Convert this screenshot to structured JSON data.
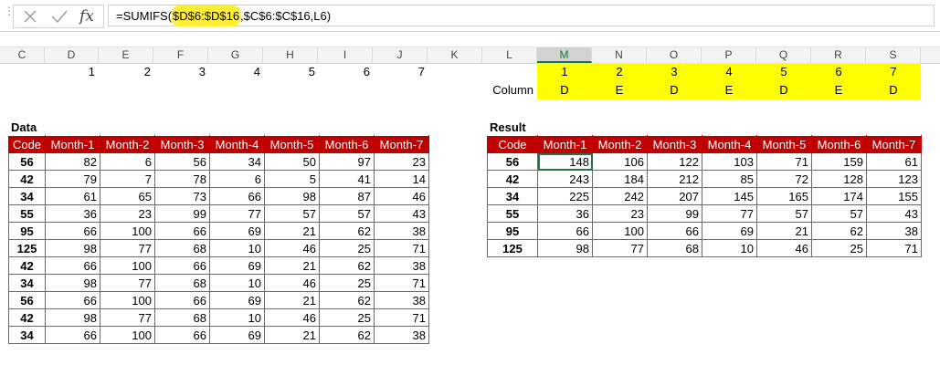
{
  "formula_bar": {
    "cancel_icon": "x-icon",
    "enter_icon": "check-icon",
    "fx_label": "fx",
    "formula_prefix": "=SUMIFS(",
    "formula_highlight": "$D$6:$D$16",
    "formula_suffix": ",$C$6:$C$16,L6)",
    "highlight_color": "#ffee33"
  },
  "column_headers": [
    "C",
    "D",
    "E",
    "F",
    "G",
    "H",
    "I",
    "J",
    "K",
    "L",
    "M",
    "N",
    "O",
    "P",
    "Q",
    "R",
    "S"
  ],
  "selected_column": "M",
  "index_row_left": [
    "1",
    "2",
    "3",
    "4",
    "5",
    "6",
    "7"
  ],
  "column_label": "Column",
  "index_row_right": [
    "1",
    "2",
    "3",
    "4",
    "5",
    "6",
    "7"
  ],
  "letter_row_right": [
    "D",
    "E",
    "D",
    "E",
    "D",
    "E",
    "D"
  ],
  "data_table": {
    "title": "Data",
    "headers": [
      "Code",
      "Month-1",
      "Month-2",
      "Month-3",
      "Month-4",
      "Month-5",
      "Month-6",
      "Month-7"
    ],
    "rows": [
      [
        "56",
        "82",
        "6",
        "56",
        "34",
        "50",
        "97",
        "23"
      ],
      [
        "42",
        "79",
        "7",
        "78",
        "6",
        "5",
        "41",
        "14"
      ],
      [
        "34",
        "61",
        "65",
        "73",
        "66",
        "98",
        "87",
        "46"
      ],
      [
        "55",
        "36",
        "23",
        "99",
        "77",
        "57",
        "57",
        "43"
      ],
      [
        "95",
        "66",
        "100",
        "66",
        "69",
        "21",
        "62",
        "38"
      ],
      [
        "125",
        "98",
        "77",
        "68",
        "10",
        "46",
        "25",
        "71"
      ],
      [
        "42",
        "66",
        "100",
        "66",
        "69",
        "21",
        "62",
        "38"
      ],
      [
        "34",
        "98",
        "77",
        "68",
        "10",
        "46",
        "25",
        "71"
      ],
      [
        "56",
        "66",
        "100",
        "66",
        "69",
        "21",
        "62",
        "38"
      ],
      [
        "42",
        "98",
        "77",
        "68",
        "10",
        "46",
        "25",
        "71"
      ],
      [
        "34",
        "66",
        "100",
        "66",
        "69",
        "21",
        "62",
        "38"
      ]
    ]
  },
  "result_table": {
    "title": "Result",
    "headers": [
      "Code",
      "Month-1",
      "Month-2",
      "Month-3",
      "Month-4",
      "Month-5",
      "Month-6",
      "Month-7"
    ],
    "rows": [
      [
        "56",
        "148",
        "106",
        "122",
        "103",
        "71",
        "159",
        "61"
      ],
      [
        "42",
        "243",
        "184",
        "212",
        "85",
        "72",
        "128",
        "123"
      ],
      [
        "34",
        "225",
        "242",
        "207",
        "145",
        "165",
        "174",
        "155"
      ],
      [
        "55",
        "36",
        "23",
        "99",
        "77",
        "57",
        "57",
        "43"
      ],
      [
        "95",
        "66",
        "100",
        "66",
        "69",
        "21",
        "62",
        "38"
      ],
      [
        "125",
        "98",
        "77",
        "68",
        "10",
        "46",
        "25",
        "71"
      ]
    ]
  },
  "colors": {
    "header_red": "#c00000",
    "yellow": "#ffff00",
    "excel_green": "#217346"
  }
}
